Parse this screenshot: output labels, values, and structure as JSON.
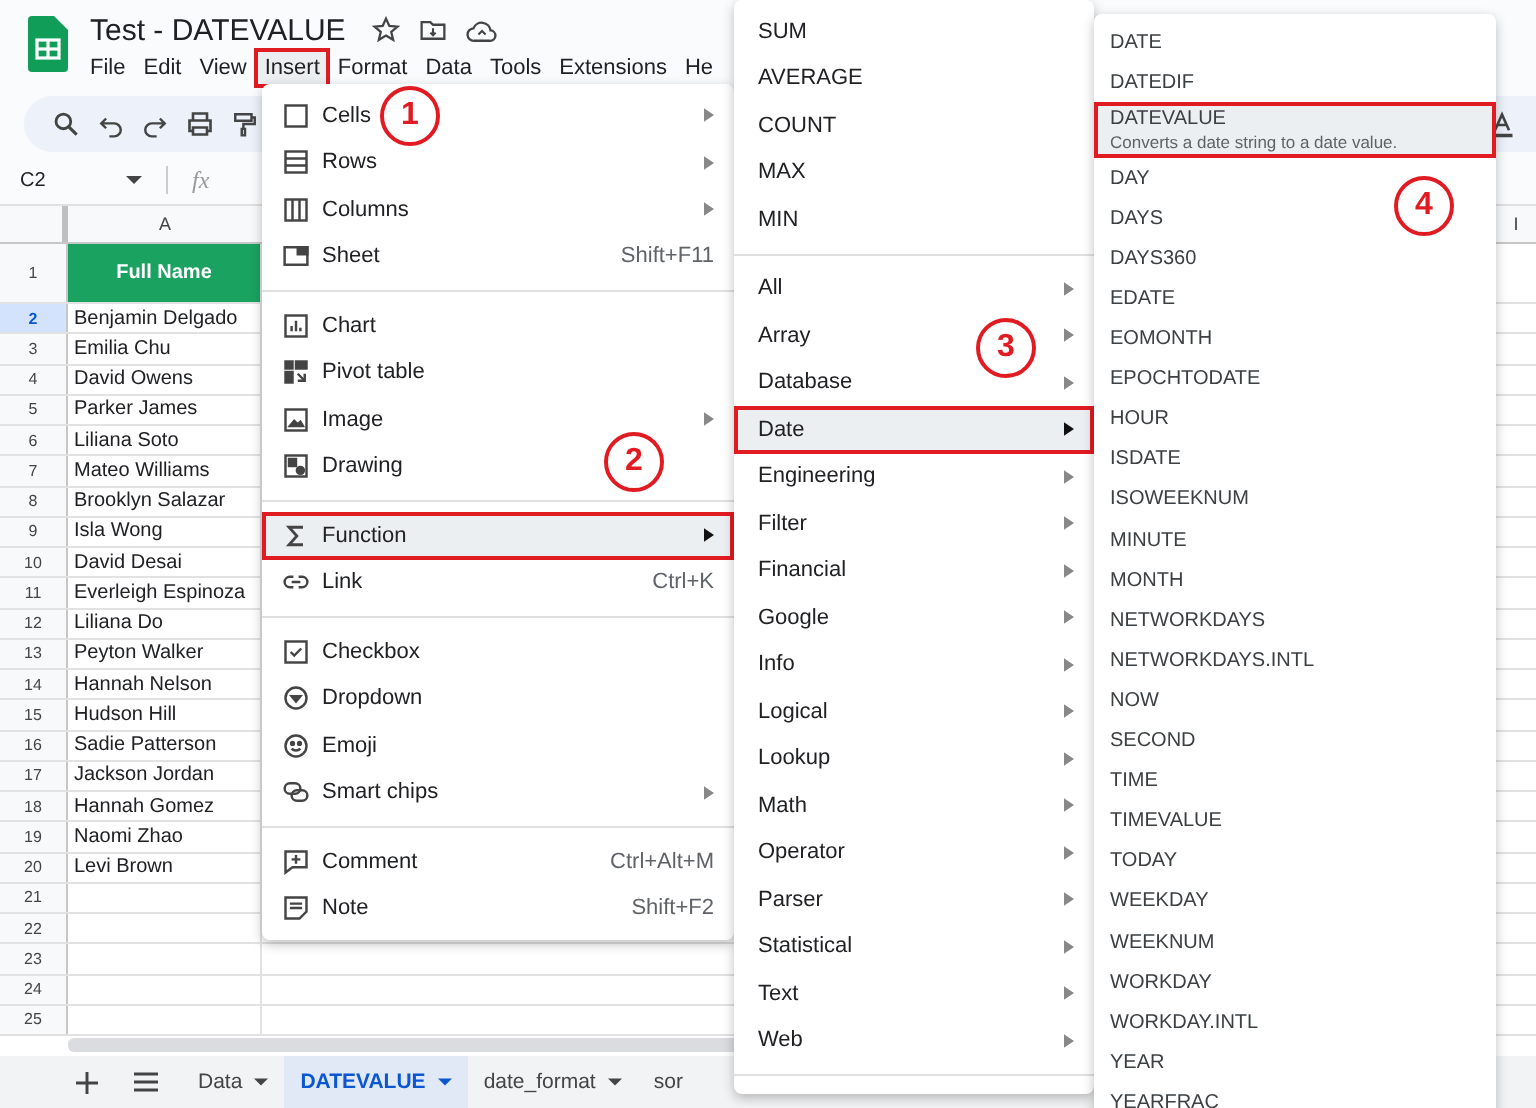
{
  "app": {
    "title": "Test - DATEVALUE",
    "menu_bar": [
      {
        "label": "File",
        "selected": false
      },
      {
        "label": "Edit",
        "selected": false
      },
      {
        "label": "View",
        "selected": false
      },
      {
        "label": "Insert",
        "selected": true
      },
      {
        "label": "Format",
        "selected": false
      },
      {
        "label": "Data",
        "selected": false
      },
      {
        "label": "Tools",
        "selected": false
      },
      {
        "label": "Extensions",
        "selected": false
      },
      {
        "label": "He",
        "selected": false
      }
    ]
  },
  "name_box": {
    "value": "C2"
  },
  "formula_bar": {
    "label": "fx"
  },
  "sheet": {
    "columns": [
      "A",
      "I"
    ],
    "header_row": {
      "number": "1",
      "text": "Full Name"
    },
    "rows": [
      {
        "number": "2",
        "name": "Benjamin Delgado",
        "selected": true
      },
      {
        "number": "3",
        "name": "Emilia Chu",
        "selected": false
      },
      {
        "number": "4",
        "name": "David Owens",
        "selected": false
      },
      {
        "number": "5",
        "name": "Parker James",
        "selected": false
      },
      {
        "number": "6",
        "name": "Liliana Soto",
        "selected": false
      },
      {
        "number": "7",
        "name": "Mateo Williams",
        "selected": false
      },
      {
        "number": "8",
        "name": "Brooklyn Salazar",
        "selected": false
      },
      {
        "number": "9",
        "name": "Isla Wong",
        "selected": false
      },
      {
        "number": "10",
        "name": "David Desai",
        "selected": false
      },
      {
        "number": "11",
        "name": "Everleigh Espinoza",
        "selected": false
      },
      {
        "number": "12",
        "name": "Liliana Do",
        "selected": false
      },
      {
        "number": "13",
        "name": "Peyton Walker",
        "selected": false
      },
      {
        "number": "14",
        "name": "Hannah Nelson",
        "selected": false
      },
      {
        "number": "15",
        "name": "Hudson Hill",
        "selected": false
      },
      {
        "number": "16",
        "name": "Sadie Patterson",
        "selected": false
      },
      {
        "number": "17",
        "name": "Jackson Jordan",
        "selected": false
      },
      {
        "number": "18",
        "name": "Hannah Gomez",
        "selected": false
      },
      {
        "number": "19",
        "name": "Naomi Zhao",
        "selected": false
      },
      {
        "number": "20",
        "name": "Levi Brown",
        "selected": false
      },
      {
        "number": "21",
        "selected": false
      },
      {
        "number": "22",
        "selected": false
      },
      {
        "number": "23",
        "selected": false
      },
      {
        "number": "24",
        "selected": false
      },
      {
        "number": "25",
        "selected": false
      }
    ]
  },
  "insert_menu": {
    "groups": [
      [
        {
          "label": "Cells",
          "submenu": true,
          "selected": false
        },
        {
          "label": "Rows",
          "submenu": true,
          "selected": false
        },
        {
          "label": "Columns",
          "submenu": true,
          "selected": false
        },
        {
          "label": "Sheet",
          "shortcut": "Shift+F11",
          "submenu": false,
          "selected": false
        }
      ],
      [
        {
          "label": "Chart",
          "submenu": false,
          "selected": false
        },
        {
          "label": "Pivot table",
          "submenu": false,
          "selected": false
        },
        {
          "label": "Image",
          "submenu": true,
          "selected": false
        },
        {
          "label": "Drawing",
          "submenu": false,
          "selected": false
        }
      ],
      [
        {
          "label": "Function",
          "submenu": true,
          "selected": true
        },
        {
          "label": "Link",
          "shortcut": "Ctrl+K",
          "submenu": false,
          "selected": false
        }
      ],
      [
        {
          "label": "Checkbox",
          "submenu": false,
          "selected": false
        },
        {
          "label": "Dropdown",
          "submenu": false,
          "selected": false
        },
        {
          "label": "Emoji",
          "submenu": false,
          "selected": false
        },
        {
          "label": "Smart chips",
          "submenu": true,
          "selected": false
        }
      ],
      [
        {
          "label": "Comment",
          "shortcut": "Ctrl+Alt+M",
          "submenu": false,
          "selected": false
        },
        {
          "label": "Note",
          "shortcut": "Shift+F2",
          "submenu": false,
          "selected": false
        }
      ]
    ]
  },
  "functions_menu": {
    "groups": [
      [
        {
          "label": "SUM",
          "submenu": false,
          "selected": false
        },
        {
          "label": "AVERAGE",
          "submenu": false,
          "selected": false
        },
        {
          "label": "COUNT",
          "submenu": false,
          "selected": false
        },
        {
          "label": "MAX",
          "submenu": false,
          "selected": false
        },
        {
          "label": "MIN",
          "submenu": false,
          "selected": false
        }
      ],
      [
        {
          "label": "All",
          "submenu": true,
          "selected": false
        },
        {
          "label": "Array",
          "submenu": true,
          "selected": false
        },
        {
          "label": "Database",
          "submenu": true,
          "selected": false
        },
        {
          "label": "Date",
          "submenu": true,
          "selected": true
        },
        {
          "label": "Engineering",
          "submenu": true,
          "selected": false
        },
        {
          "label": "Filter",
          "submenu": true,
          "selected": false
        },
        {
          "label": "Financial",
          "submenu": true,
          "selected": false
        },
        {
          "label": "Google",
          "submenu": true,
          "selected": false
        },
        {
          "label": "Info",
          "submenu": true,
          "selected": false
        },
        {
          "label": "Logical",
          "submenu": true,
          "selected": false
        },
        {
          "label": "Lookup",
          "submenu": true,
          "selected": false
        },
        {
          "label": "Math",
          "submenu": true,
          "selected": false
        },
        {
          "label": "Operator",
          "submenu": true,
          "selected": false
        },
        {
          "label": "Parser",
          "submenu": true,
          "selected": false
        },
        {
          "label": "Statistical",
          "submenu": true,
          "selected": false
        },
        {
          "label": "Text",
          "submenu": true,
          "selected": false
        },
        {
          "label": "Web",
          "submenu": true,
          "selected": false
        }
      ]
    ]
  },
  "date_menu": {
    "items": [
      {
        "label": "DATE",
        "selected": false
      },
      {
        "label": "DATEDIF",
        "selected": false
      },
      {
        "label": "DATEVALUE",
        "description": "Converts a date string to a date value.",
        "selected": true
      },
      {
        "label": "DAY",
        "selected": false
      },
      {
        "label": "DAYS",
        "selected": false
      },
      {
        "label": "DAYS360",
        "selected": false
      },
      {
        "label": "EDATE",
        "selected": false
      },
      {
        "label": "EOMONTH",
        "selected": false
      },
      {
        "label": "EPOCHTODATE",
        "selected": false
      },
      {
        "label": "HOUR",
        "selected": false
      },
      {
        "label": "ISDATE",
        "selected": false
      },
      {
        "label": "ISOWEEKNUM",
        "selected": false
      },
      {
        "label": "MINUTE",
        "selected": false
      },
      {
        "label": "MONTH",
        "selected": false
      },
      {
        "label": "NETWORKDAYS",
        "selected": false
      },
      {
        "label": "NETWORKDAYS.INTL",
        "selected": false
      },
      {
        "label": "NOW",
        "selected": false
      },
      {
        "label": "SECOND",
        "selected": false
      },
      {
        "label": "TIME",
        "selected": false
      },
      {
        "label": "TIMEVALUE",
        "selected": false
      },
      {
        "label": "TODAY",
        "selected": false
      },
      {
        "label": "WEEKDAY",
        "selected": false
      },
      {
        "label": "WEEKNUM",
        "selected": false
      },
      {
        "label": "WORKDAY",
        "selected": false
      },
      {
        "label": "WORKDAY.INTL",
        "selected": false
      },
      {
        "label": "YEAR",
        "selected": false
      },
      {
        "label": "YEARFRAC",
        "selected": false
      }
    ]
  },
  "sheet_tabs": [
    {
      "label": "Data",
      "selected": false,
      "dropdown": true
    },
    {
      "label": "DATEVALUE",
      "selected": true,
      "dropdown": true
    },
    {
      "label": "date_format",
      "selected": false,
      "dropdown": true
    },
    {
      "label": "sor",
      "selected": false,
      "dropdown": false
    }
  ],
  "annotations": [
    {
      "label": "1"
    },
    {
      "label": "2"
    },
    {
      "label": "3"
    },
    {
      "label": "4"
    }
  ]
}
